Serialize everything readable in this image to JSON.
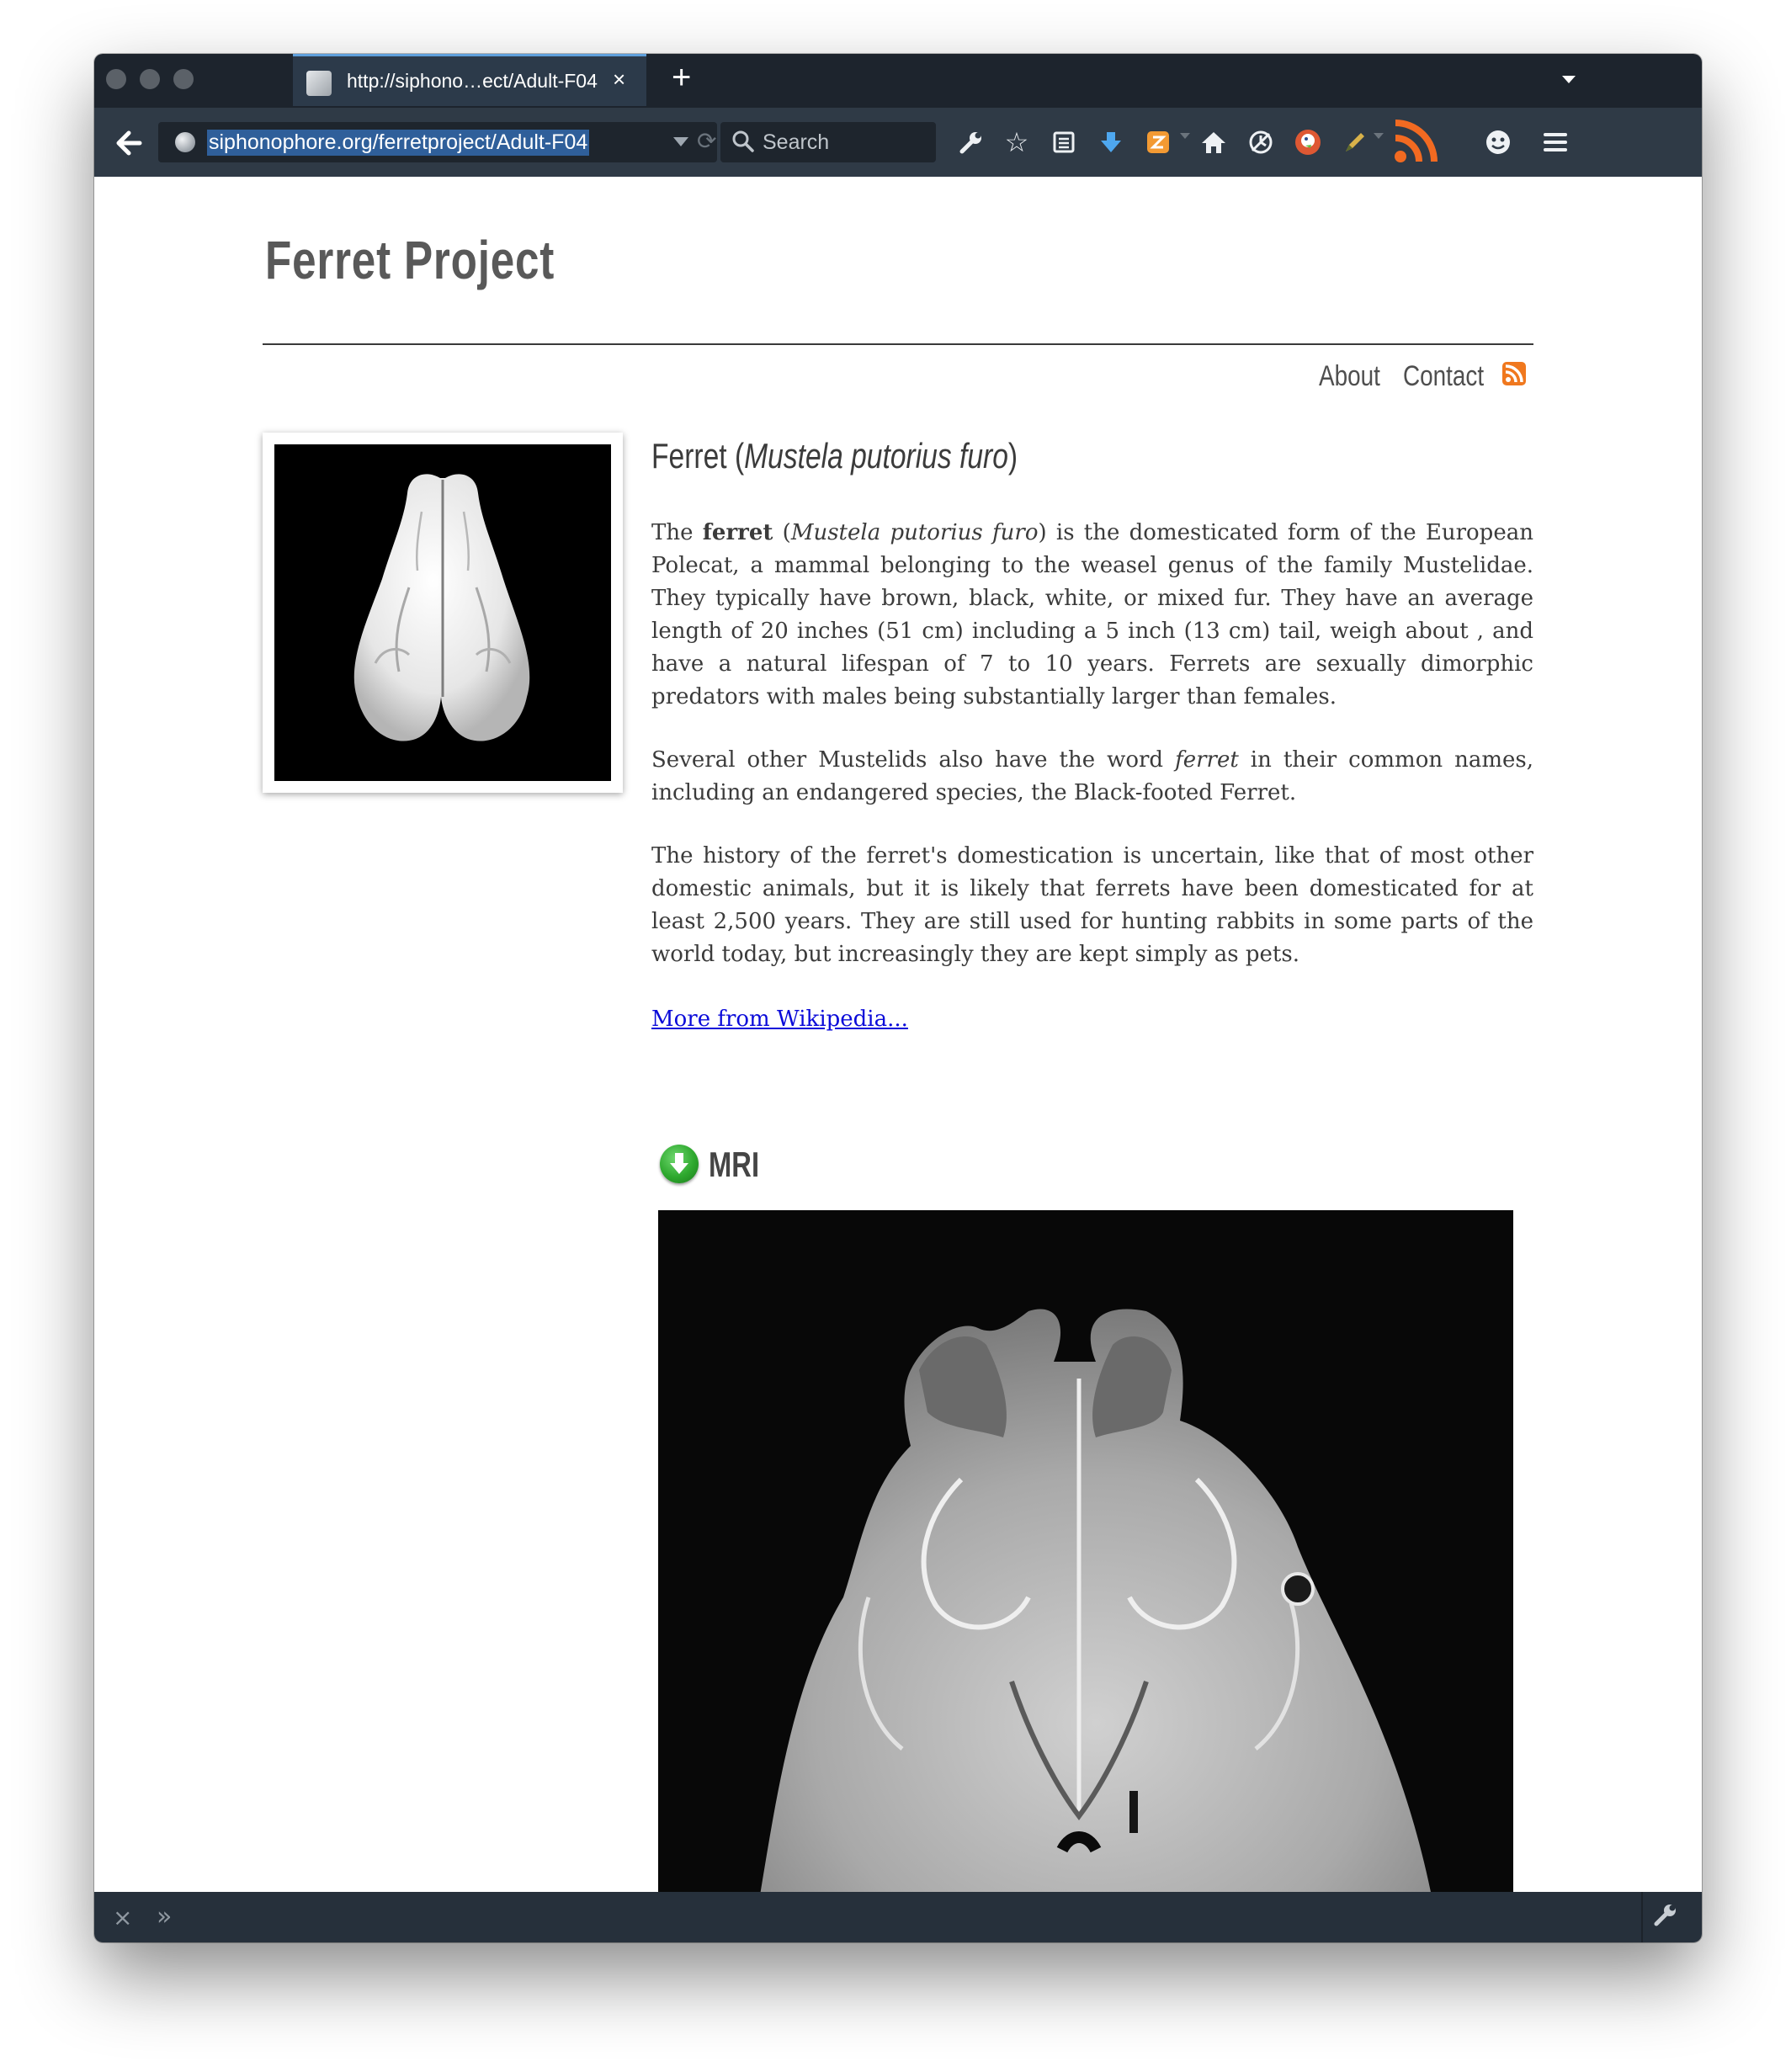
{
  "browser": {
    "tab": {
      "title": "http://siphono…ect/Adult-F04",
      "close": "×"
    },
    "new_tab": "+",
    "url": "siphonophore.org/ferretproject/Adult-F04",
    "search_placeholder": "Search"
  },
  "site": {
    "title": "Ferret Project",
    "nav": {
      "about": "About",
      "contact": "Contact"
    }
  },
  "article": {
    "heading_prefix": "Ferret (",
    "heading_species": "Mustela putorius furo",
    "heading_suffix": ")",
    "p1": {
      "a": "The ",
      "b": "ferret",
      "c": " (",
      "d": "Mustela putorius furo",
      "e": ") is the domesticated form of the European Polecat, a mammal belonging to the weasel genus of the family Mustelidae. They typically have brown, black, white, or mixed fur. They have an average length of 20 inches (51 cm) including a 5 inch (13 cm) tail, weigh about , and have a natural lifespan of 7 to 10 years. Ferrets are sexually dimorphic predators with males being substantially larger than females."
    },
    "p2": {
      "a": "Several other Mustelids also have the word ",
      "b": "ferret",
      "c": " in their common names, including an endangered species, the Black-footed Ferret."
    },
    "p3": "The history of the ferret's domestication is uncertain, like that of most other domestic animals, but it is likely that ferrets have been domesticated for at least 2,500 years. They are still used for hunting rabbits in some parts of the world today, but increasingly they are kept simply as pets.",
    "wiki_link": "More from Wikipedia..."
  },
  "mri": {
    "title": "MRI"
  },
  "bottom": {
    "close": "×",
    "more": "»"
  },
  "icons": {
    "toolbar": [
      "back-arrow-icon",
      "globe-icon",
      "search-icon",
      "wrench-icon",
      "star-icon",
      "reading-list-icon",
      "download-icon",
      "extension-icon",
      "home-icon",
      "history-icon",
      "duckduckgo-icon",
      "pencil-icon",
      "rss-feed-icon",
      "emoji-icon",
      "menu-icon"
    ]
  },
  "colors": {
    "tabbar": "#1d242d",
    "toolbar": "#2f3a46",
    "link": "#0b0bd9",
    "rss": "#f0781e",
    "download_green": "#2ea82e"
  }
}
